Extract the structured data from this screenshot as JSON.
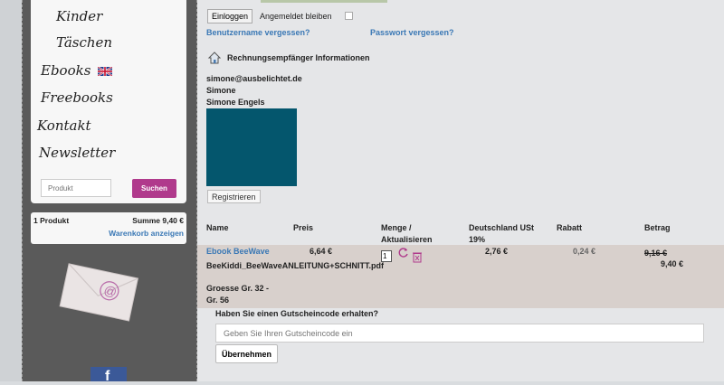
{
  "sidebar": {
    "menu": [
      "Kinder",
      "Täschen",
      "Ebooks",
      "Freebooks",
      "Kontakt",
      "Newsletter"
    ],
    "search": {
      "placeholder": "Produkt",
      "button": "Suchen"
    },
    "cart": {
      "count": "1 Produkt",
      "sum": "Summe 9,40 €",
      "link": "Warenkorb anzeigen"
    },
    "social": "f"
  },
  "login": {
    "button": "Einloggen",
    "stay_logged_in": "Angemeldet bleiben",
    "forgot_user": "Benutzername vergessen?",
    "forgot_password": "Passwort vergessen?"
  },
  "billing": {
    "heading": "Rechnungsempfänger Informationen",
    "email": "simone@ausbelichtet.de",
    "first": "Simone",
    "full": "Simone Engels",
    "register": "Registrieren"
  },
  "table": {
    "headers": [
      "Name",
      "Preis",
      "Menge /",
      "Aktualisieren",
      "Deutschland USt",
      "19%",
      "Rabatt",
      "Betrag"
    ],
    "row": {
      "product": "Ebook BeeWave",
      "file": "BeeKiddi_BeeWaveANLEITUNG+SCHNITT.pdf",
      "size_line1": "Groesse Gr. 32 -",
      "size_line2": "Gr. 56",
      "price": "6,64 €",
      "qty": "1",
      "tax": "2,76 €",
      "discount": "0,24 €",
      "old_total": "9,16 €",
      "total": "9,40 €"
    }
  },
  "coupon": {
    "question": "Haben Sie einen Gutscheincode erhalten?",
    "placeholder": "Geben Sie Ihren Gutscheincode ein",
    "apply": "Übernehmen"
  }
}
